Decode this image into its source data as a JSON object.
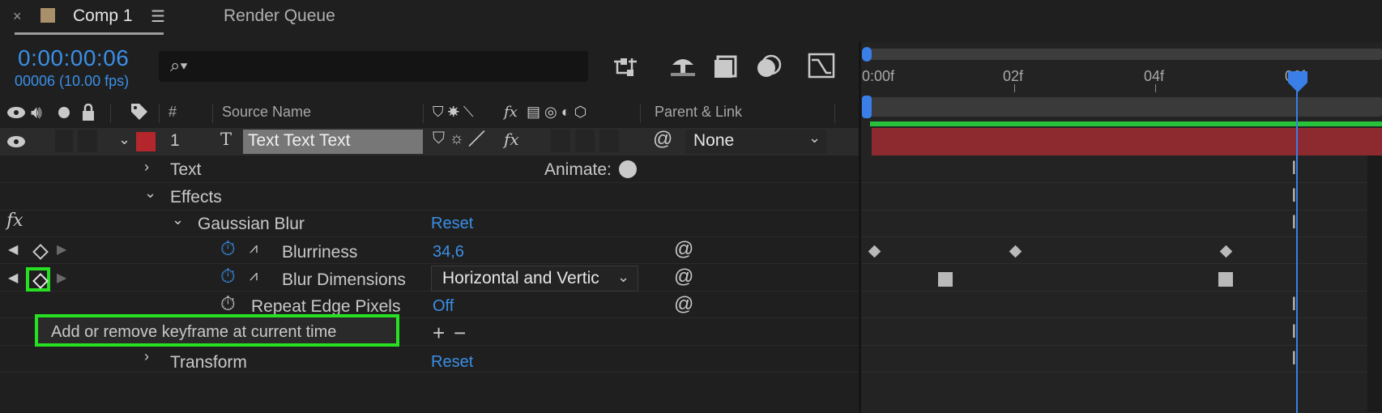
{
  "tabs": {
    "close_glyph": "×",
    "active_title": "Comp 1",
    "menu_glyph": "☰",
    "render_queue": "Render Queue"
  },
  "header": {
    "timecode": "0:00:00:06",
    "frames": "00006 (10.00 fps)"
  },
  "columns": {
    "number": "#",
    "source_name": "Source Name",
    "fx": "fx",
    "parent_link": "Parent & Link"
  },
  "layer": {
    "index": "1",
    "type_glyph": "T",
    "name": "Text Text  Text",
    "parent_value": "None",
    "label_color": "#b3262c"
  },
  "properties": {
    "text": "Text",
    "animate_label": "Animate:",
    "effects": "Effects",
    "fx_badge": "fx",
    "gaussian_blur": "Gaussian Blur",
    "gaussian_reset": "Reset",
    "blurriness": "Blurriness",
    "blurriness_value": "34,6",
    "blur_dimensions": "Blur Dimensions",
    "blur_dimensions_value": "Horizontal and Vertic",
    "repeat_edge": "Repeat Edge Pixels",
    "repeat_edge_value": "Off",
    "transform": "Transform",
    "transform_reset": "Reset"
  },
  "tooltip": {
    "text": "Add or remove keyframe at current time"
  },
  "timeline": {
    "ruler_labels": [
      "0:00f",
      "02f",
      "04f",
      "06f"
    ],
    "accent": "#3a7ee8",
    "highlight": "#27e021"
  }
}
